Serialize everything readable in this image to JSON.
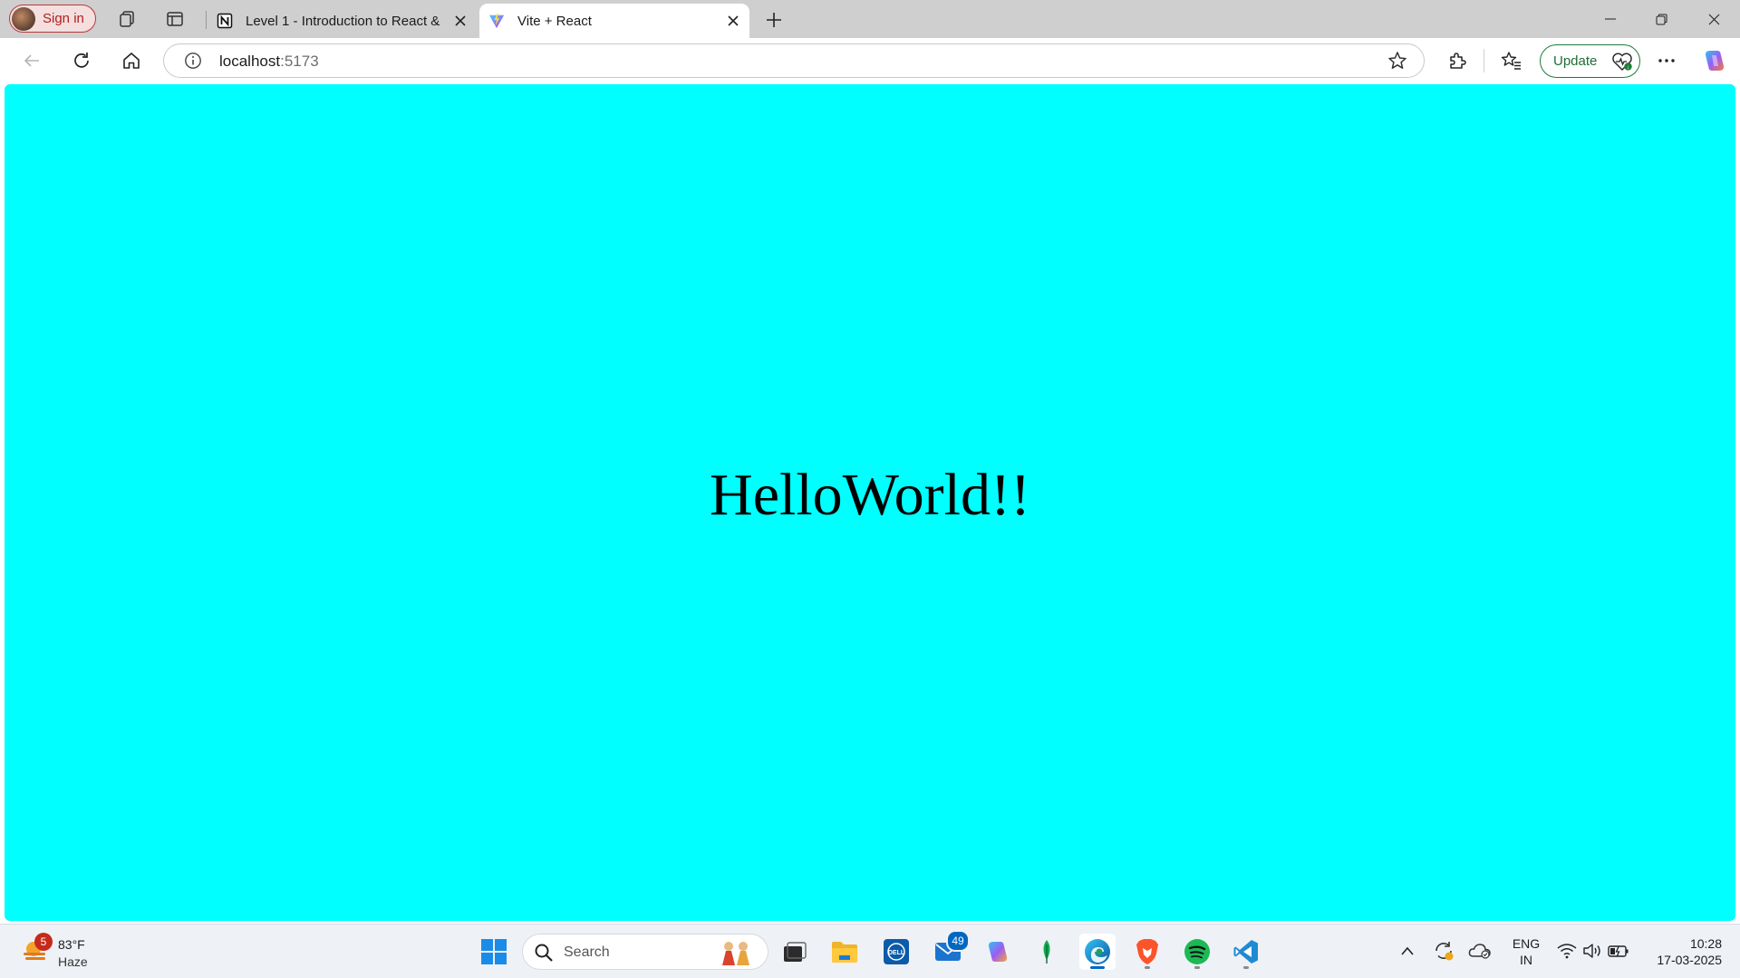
{
  "browser": {
    "signin_label": "Sign in",
    "tabs": [
      {
        "title": "Level 1 - Introduction to React &",
        "favicon": "notion-icon",
        "active": false
      },
      {
        "title": "Vite + React",
        "favicon": "vite-icon",
        "active": true
      }
    ],
    "address": {
      "host": "localhost",
      "port": ":5173"
    },
    "update_label": "Update"
  },
  "page": {
    "background": "#00ffff",
    "heading": "HelloWorld!!"
  },
  "taskbar": {
    "weather": {
      "badge": "5",
      "temp": "83°F",
      "condition": "Haze"
    },
    "search_label": "Search",
    "mail_badge": "49",
    "language": {
      "line1": "ENG",
      "line2": "IN"
    },
    "clock": {
      "time": "10:28",
      "date": "17-03-2025"
    }
  },
  "colors": {
    "page_bg": "#00ffff",
    "signin_accent": "#b01f1f",
    "update_accent": "#1e7d3a",
    "taskbar_accent": "#0067c0"
  }
}
